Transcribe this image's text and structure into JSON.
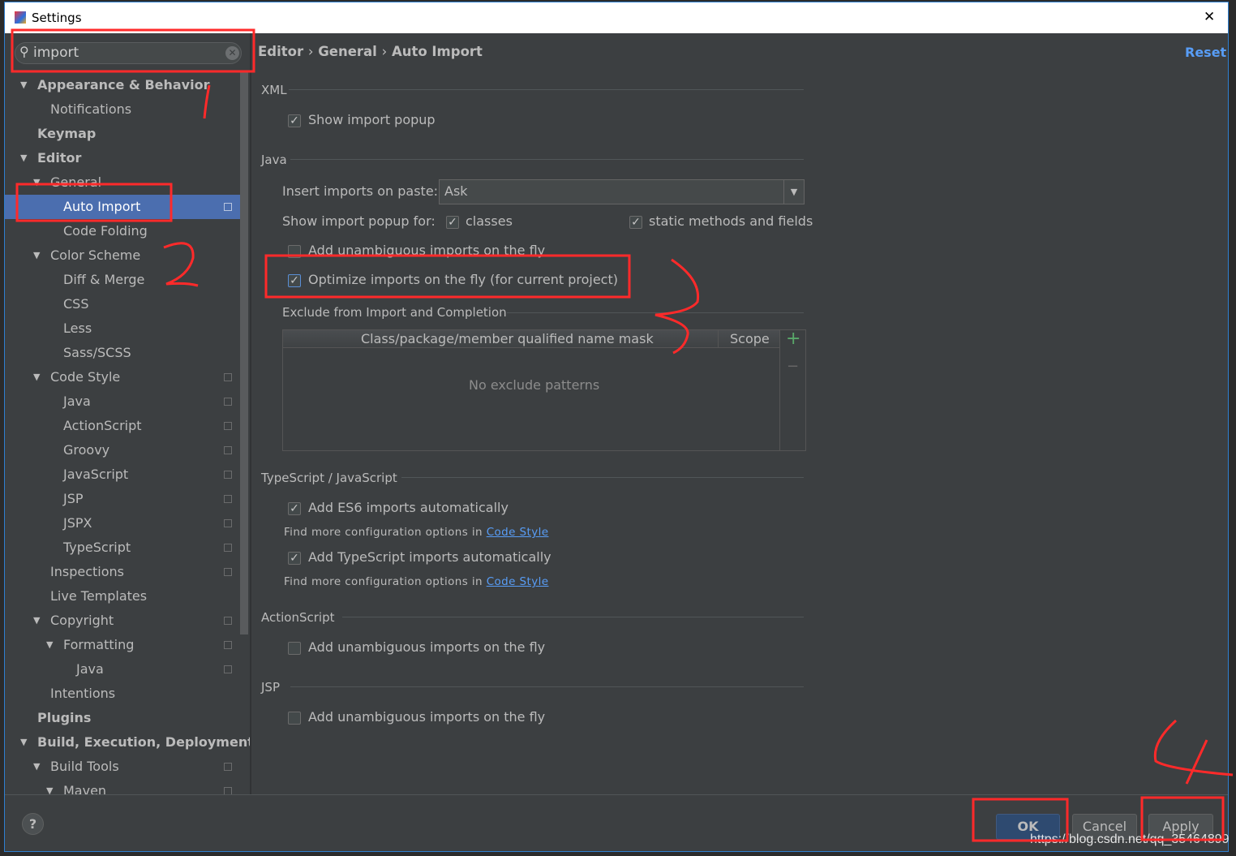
{
  "window": {
    "title": "Settings",
    "close_label": "✕"
  },
  "search": {
    "value": "import"
  },
  "sidebar": {
    "items": [
      {
        "label": "Appearance & Behavior",
        "level": 0,
        "bold": true,
        "arrow": true
      },
      {
        "label": "Notifications",
        "level": 1
      },
      {
        "label": "Keymap",
        "level": 0,
        "bold": true
      },
      {
        "label": "Editor",
        "level": 0,
        "bold": true,
        "arrow": true
      },
      {
        "label": "General",
        "level": 1,
        "arrow": true
      },
      {
        "label": "Auto Import",
        "level": 2,
        "selected": true,
        "copy": true
      },
      {
        "label": "Code Folding",
        "level": 2
      },
      {
        "label": "Color Scheme",
        "level": 1,
        "arrow": true
      },
      {
        "label": "Diff & Merge",
        "level": 2
      },
      {
        "label": "CSS",
        "level": 2
      },
      {
        "label": "Less",
        "level": 2
      },
      {
        "label": "Sass/SCSS",
        "level": 2
      },
      {
        "label": "Code Style",
        "level": 1,
        "arrow": true,
        "copy": true
      },
      {
        "label": "Java",
        "level": 2,
        "copy": true
      },
      {
        "label": "ActionScript",
        "level": 2,
        "copy": true
      },
      {
        "label": "Groovy",
        "level": 2,
        "copy": true
      },
      {
        "label": "JavaScript",
        "level": 2,
        "copy": true
      },
      {
        "label": "JSP",
        "level": 2,
        "copy": true
      },
      {
        "label": "JSPX",
        "level": 2,
        "copy": true
      },
      {
        "label": "TypeScript",
        "level": 2,
        "copy": true
      },
      {
        "label": "Inspections",
        "level": 1,
        "copy": true
      },
      {
        "label": "Live Templates",
        "level": 1
      },
      {
        "label": "Copyright",
        "level": 1,
        "arrow": true,
        "copy": true
      },
      {
        "label": "Formatting",
        "level": 2,
        "arrow": true,
        "copy": true
      },
      {
        "label": "Java",
        "level": 3,
        "copy": true
      },
      {
        "label": "Intentions",
        "level": 1
      },
      {
        "label": "Plugins",
        "level": 0,
        "bold": true
      },
      {
        "label": "Build, Execution, Deployment",
        "level": 0,
        "bold": true,
        "arrow": true
      },
      {
        "label": "Build Tools",
        "level": 1,
        "arrow": true,
        "copy": true
      },
      {
        "label": "Maven",
        "level": 2,
        "arrow": true,
        "copy": true
      }
    ]
  },
  "breadcrumb": {
    "p1": "Editor",
    "p2": "General",
    "p3": "Auto Import",
    "sep": "›"
  },
  "reset_label": "Reset",
  "xml": {
    "title": "XML",
    "show_popup": "Show import popup"
  },
  "java": {
    "title": "Java",
    "insert_label": "Insert imports on paste:",
    "insert_value": "Ask",
    "popup_for": "Show import popup for:",
    "classes": "classes",
    "static": "static methods and fields",
    "unambiguous": "Add unambiguous imports on the fly",
    "optimize": "Optimize imports on the fly (for current project)"
  },
  "exclude": {
    "title": "Exclude from Import and Completion",
    "col1": "Class/package/member qualified name mask",
    "col2": "Scope",
    "empty": "No exclude patterns",
    "add": "+",
    "remove": "−"
  },
  "ts": {
    "title": "TypeScript / JavaScript",
    "es6": "Add ES6 imports automatically",
    "more": "Find more configuration options in",
    "link": "Code Style",
    "tsauto": "Add TypeScript imports automatically"
  },
  "as": {
    "title": "ActionScript",
    "unambiguous": "Add unambiguous imports on the fly"
  },
  "jsp": {
    "title": "JSP",
    "unambiguous": "Add unambiguous imports on the fly"
  },
  "footer": {
    "help": "?",
    "ok": "OK",
    "cancel": "Cancel",
    "apply": "Apply"
  },
  "watermark": "https://blog.csdn.net/qq_35464899",
  "annotations": {
    "n1": "1",
    "n2": "2",
    "n3": "3",
    "n4": "4",
    "color": "#ff2a2a"
  },
  "colors": {
    "selection": "#4b6eaf",
    "link": "#589df6",
    "ok": "#2e4a70"
  }
}
